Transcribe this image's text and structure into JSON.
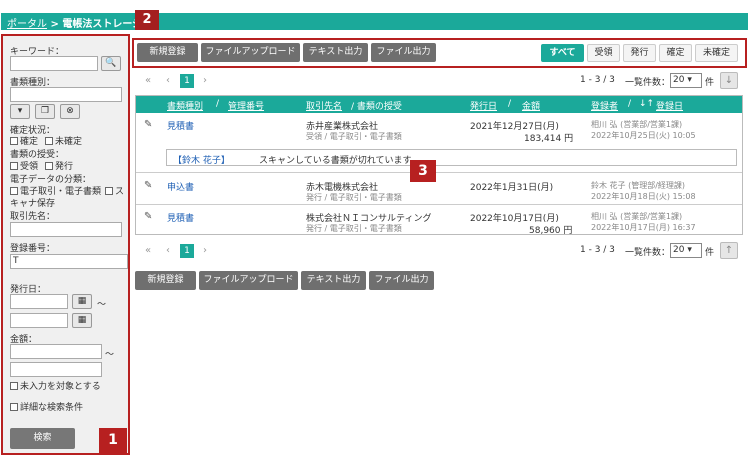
{
  "header": {
    "breadcrumb_link": "ポータル",
    "breadcrumb_sep": ">",
    "breadcrumb_current": "電帳法ストレージ",
    "tag": "2"
  },
  "sidebar": {
    "keyword_label": "キーワード：",
    "keyword_value": "",
    "doctype_label": "書類種別：",
    "doctype_value": "",
    "confirm_label": "確定状況：",
    "confirm_options": [
      "確定",
      "未確定"
    ],
    "transfer_label": "書類の授受：",
    "transfer_options": [
      "受領",
      "発行"
    ],
    "class_label": "電子データの分類：",
    "class_options": [
      "電子取引・電子書類",
      "ス"
    ],
    "class_wrap": "キャナ保存",
    "partner_label": "取引先名：",
    "partner_value": "",
    "regno_label": "登録番号：",
    "regno_value": "T",
    "issue_label": "発行日：",
    "tilde": "～",
    "amount_label": "金額：",
    "include_empty": "未入力を対象とする",
    "advanced": "詳細な検索条件",
    "search_btn": "検索",
    "tag": "1"
  },
  "toolbar": {
    "new_btn": "新規登録",
    "upload_btn": "ファイルアップロード",
    "text_btn": "テキスト出力",
    "file_btn": "ファイル出力",
    "filters": [
      "すべて",
      "受領",
      "発行",
      "確定",
      "未確定"
    ],
    "active_filter": "すべて"
  },
  "pager": {
    "first": "«",
    "prev": "‹",
    "page": "1",
    "next": "›",
    "count": "1 - 3 / 3",
    "per_page_label": "一覧件数：",
    "per_page": "20",
    "unit": "件"
  },
  "table": {
    "columns": {
      "doctype": "書類種別",
      "mgmt": "管理番号",
      "partner": "取引先名",
      "transfer": "/ 書類の授受",
      "issue": "発行日",
      "amount": "金額",
      "registrant": "登録者",
      "regdate": "登録日",
      "sort_icon": "↓↑"
    },
    "rows": [
      {
        "doctype": "見積書",
        "partner": "赤井産業株式会社",
        "sub": "受領 / 電子取引・電子書類",
        "date": "2021年12月27日(月)",
        "amount": "183,414 円",
        "registrant": "相川 弘 (営業部/営業1課)",
        "regdate": "2022年10月25日(火) 10:05"
      },
      {
        "doctype": "申込書",
        "partner": "赤木電機株式会社",
        "sub": "発行 / 電子取引・電子書類",
        "date": "2022年1月31日(月)",
        "amount": "",
        "registrant": "鈴木 花子 (管理部/経理課)",
        "regdate": "2022年10月18日(火) 15:08"
      },
      {
        "doctype": "見積書",
        "partner": "株式会社ＮＩコンサルティング",
        "sub": "発行 / 電子取引・電子書類",
        "date": "2022年10月17日(月)",
        "amount": "58,960 円",
        "registrant": "相川 弘 (営業部/営業1課)",
        "regdate": "2022年10月17日(月) 16:37"
      }
    ],
    "memo_who": "【鈴木 花子】",
    "memo_text": "スキャンしている書類が切れています。",
    "tag": "3"
  },
  "colors": {
    "accent": "#1ba99a",
    "tag": "#b72020",
    "link": "#1e5fb4"
  }
}
